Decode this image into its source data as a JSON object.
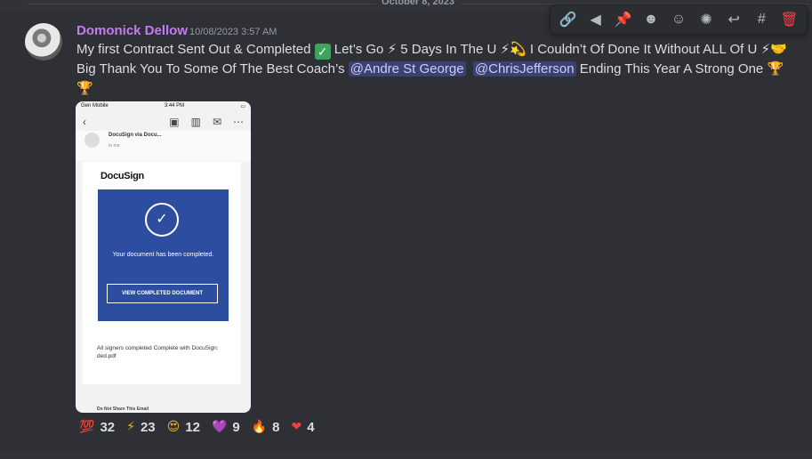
{
  "date_divider": "October 8, 2023",
  "message": {
    "author": "Domonick Dellow",
    "timestamp": "10/08/2023 3:57 AM",
    "text": {
      "p1": "My first Contract Sent Out & Completed ",
      "p2": " Let’s Go ⚡ 5 Days In The U ⚡💫 I Couldn’t Of Done It Without ALL Of U ⚡🤝 Big Thank You To Some Of The Best Coach’s ",
      "mention1": "@Andre St George",
      "mention2": "@ChrisJefferson",
      "p3": " Ending This Year A Strong One 🏆🏆"
    }
  },
  "attachment": {
    "carrier": "Gen Mobile",
    "time": "3:44 PM",
    "sender": "DocuSign via Docu...",
    "to_me": "to me",
    "logo": "DocuSign",
    "status": "Your document has been completed.",
    "button": "VIEW COMPLETED DOCUMENT",
    "signers": "All signers completed Complete with DocuSign: ded.pdf",
    "footer": "Do Not Share This Email"
  },
  "toolbar_icons": [
    "link-icon",
    "megaphone-icon",
    "pin-icon",
    "emoji-icon",
    "emoji-add-icon",
    "super-react-icon",
    "reply-icon",
    "thread-icon",
    "trash-icon"
  ],
  "reactions": [
    {
      "icon": "💯",
      "count": "32"
    },
    {
      "icon": "⚡",
      "count": "23"
    },
    {
      "icon": "😍",
      "count": "12"
    },
    {
      "icon": "💜",
      "count": "9"
    },
    {
      "icon": "🔥",
      "count": "8"
    },
    {
      "icon": "❤",
      "count": "4"
    }
  ]
}
